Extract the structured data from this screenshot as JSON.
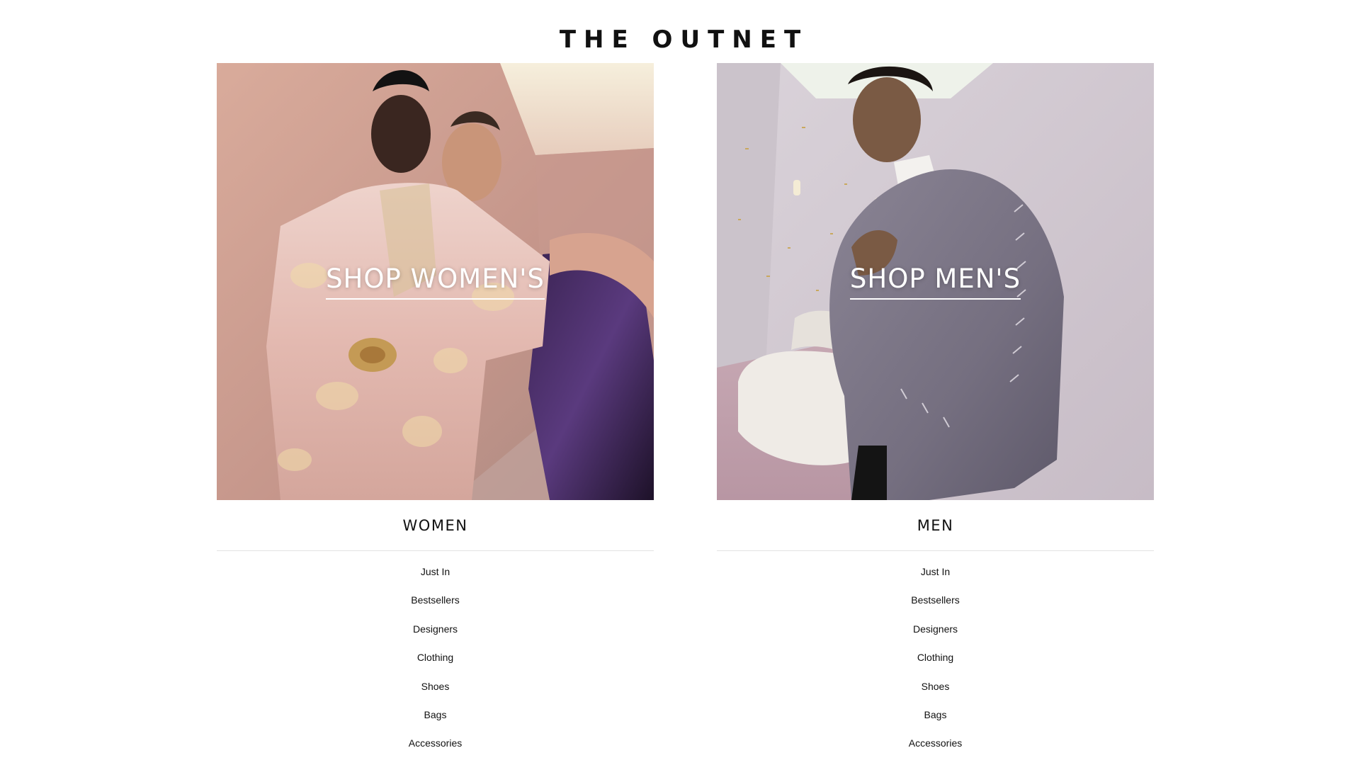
{
  "brand": {
    "logo_text": "THE OUTNET"
  },
  "women": {
    "cta_label": "SHOP WOMEN'S",
    "heading": "WOMEN",
    "links": [
      "Just In",
      "Bestsellers",
      "Designers",
      "Clothing",
      "Shoes",
      "Bags",
      "Accessories"
    ]
  },
  "men": {
    "cta_label": "SHOP MEN'S",
    "heading": "MEN",
    "links": [
      "Just In",
      "Bestsellers",
      "Designers",
      "Clothing",
      "Shoes",
      "Bags",
      "Accessories"
    ]
  },
  "colors": {
    "text": "#111111",
    "divider": "#e3e3e3",
    "women_backdrop": "#c89a8c",
    "men_backdrop": "#cfc8cf"
  }
}
